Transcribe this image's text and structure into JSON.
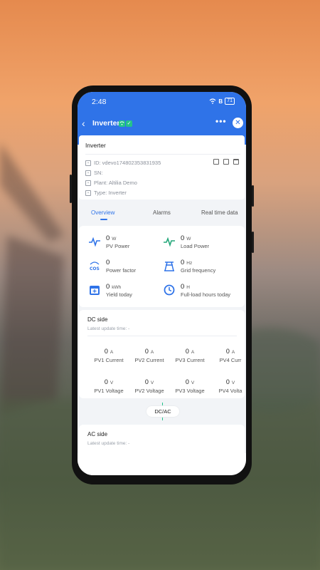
{
  "status_bar": {
    "time": "2:48",
    "battery": "71"
  },
  "nav": {
    "back": "‹",
    "title": "Inverter",
    "more": "•••",
    "close": "✕"
  },
  "info": {
    "title": "Inverter",
    "id": "ID: vdevo174802353831935",
    "sn": "SN:",
    "plant": "Plant: Altilia Demo",
    "type": "Type: Inverter"
  },
  "tabs": [
    "Overview",
    "Alarms",
    "Real time data"
  ],
  "overview": [
    {
      "value": "0",
      "unit": "W",
      "label": "PV Power",
      "icon": "pv-power-icon",
      "color": "#2f73e8"
    },
    {
      "value": "0",
      "unit": "W",
      "label": "Load Power",
      "icon": "load-power-icon",
      "color": "#24a77a"
    },
    {
      "value": "0",
      "unit": "",
      "label": "Power factor",
      "icon": "cos-icon",
      "color": "#2f73e8"
    },
    {
      "value": "0",
      "unit": "Hz",
      "label": "Grid frequency",
      "icon": "grid-tower-icon",
      "color": "#2f73e8"
    },
    {
      "value": "0",
      "unit": "kWh",
      "label": "Yield today",
      "icon": "calendar-icon",
      "color": "#2f73e8"
    },
    {
      "value": "0",
      "unit": "H",
      "label": "Full-load hours today",
      "icon": "clock-icon",
      "color": "#2f73e8"
    }
  ],
  "dc": {
    "title": "DC side",
    "update": "Latest update time: -",
    "currents": [
      {
        "value": "0",
        "unit": "A",
        "label": "PV1 Current"
      },
      {
        "value": "0",
        "unit": "A",
        "label": "PV2 Current"
      },
      {
        "value": "0",
        "unit": "A",
        "label": "PV3 Current"
      },
      {
        "value": "0",
        "unit": "A",
        "label": "PV4 Curr"
      }
    ],
    "voltages": [
      {
        "value": "0",
        "unit": "V",
        "label": "PV1 Voltage"
      },
      {
        "value": "0",
        "unit": "V",
        "label": "PV2 Voltage"
      },
      {
        "value": "0",
        "unit": "V",
        "label": "PV3 Voltage"
      },
      {
        "value": "0",
        "unit": "V",
        "label": "PV4 Volta"
      }
    ]
  },
  "dcac": "DC/AC",
  "ac": {
    "title": "AC side",
    "update": "Latest update time: -"
  },
  "colors": {
    "primary": "#2f73e8",
    "success": "#24c38a"
  }
}
